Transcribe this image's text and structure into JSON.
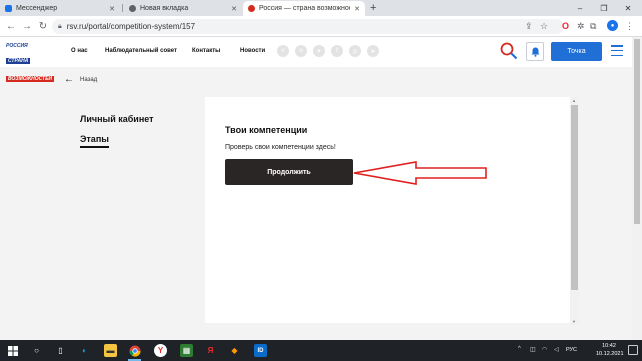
{
  "browser": {
    "tabs": [
      {
        "label": "Мессенджер",
        "favicon_color": "#1a73e8",
        "active": false
      },
      {
        "label": "Новая вкладка",
        "favicon_color": "#5f6368",
        "active": false
      },
      {
        "label": "Россия — страна возможностей",
        "favicon_color": "#d52b1e",
        "active": true
      }
    ],
    "new_tab_icon": "plus-icon",
    "address": "rsv.ru/portal/competition-system/157"
  },
  "site": {
    "logo": {
      "line1": "РОССИЯ",
      "line2": "СТРАНА",
      "line3": "ВОЗМОЖНОСТЕЙ"
    },
    "nav": [
      "О нас",
      "Наблюдательный совет",
      "Контакты",
      "Новости"
    ],
    "social_icons": [
      "vk-icon",
      "ok-icon",
      "dzen-icon",
      "facebook-icon",
      "instagram-icon",
      "telegram-icon"
    ],
    "tochka_label": "Точка",
    "accent_color": "#1f6fd6",
    "brand_red": "#d52b1e"
  },
  "page": {
    "back_label": "Назад",
    "sidebar": {
      "title": "Личный кабинет",
      "item": "Этапы"
    },
    "main": {
      "title": "Твои компетенции",
      "text": "Проверь свои компетенции здесь!",
      "button": "Продолжить"
    }
  },
  "taskbar": {
    "lang": "РУС",
    "time": "10:42",
    "date": "10.12.2021"
  }
}
